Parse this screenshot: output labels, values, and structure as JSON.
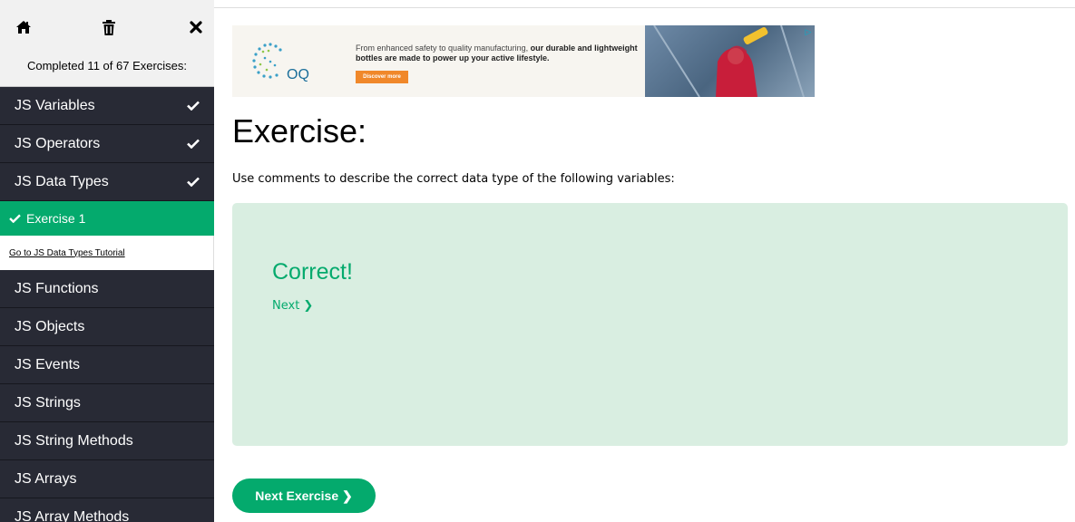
{
  "sidebar": {
    "tools": [
      {
        "name": "home-icon"
      },
      {
        "name": "trash-icon"
      },
      {
        "name": "close-icon"
      }
    ],
    "progress_text": "Completed 11 of 67 Exercises:",
    "items_before": [
      {
        "label": "JS Variables",
        "done": true
      },
      {
        "label": "JS Operators",
        "done": true
      },
      {
        "label": "JS Data Types",
        "done": true
      }
    ],
    "active_exercise": "Exercise 1",
    "tutorial_link": "Go to JS Data Types Tutorial",
    "items_after": [
      {
        "label": "JS Functions"
      },
      {
        "label": "JS Objects"
      },
      {
        "label": "JS Events"
      },
      {
        "label": "JS Strings"
      },
      {
        "label": "JS String Methods"
      },
      {
        "label": "JS Arrays"
      },
      {
        "label": "JS Array Methods"
      }
    ]
  },
  "ad": {
    "text_plain": "From enhanced safety to quality manufacturing, ",
    "text_bold": "our durable and lightweight bottles are made to power up your active lifestyle.",
    "button": "Discover more",
    "brand": "OQ"
  },
  "main": {
    "title": "Exercise:",
    "description": "Use comments to describe the correct data type of the following variables:",
    "result": "Correct!",
    "next_link": "Next ❯",
    "next_button": "Next Exercise ❯"
  },
  "colors": {
    "sidebar_bg": "#282a35",
    "accent": "#04aa6d",
    "result_bg": "#d9eee1"
  }
}
